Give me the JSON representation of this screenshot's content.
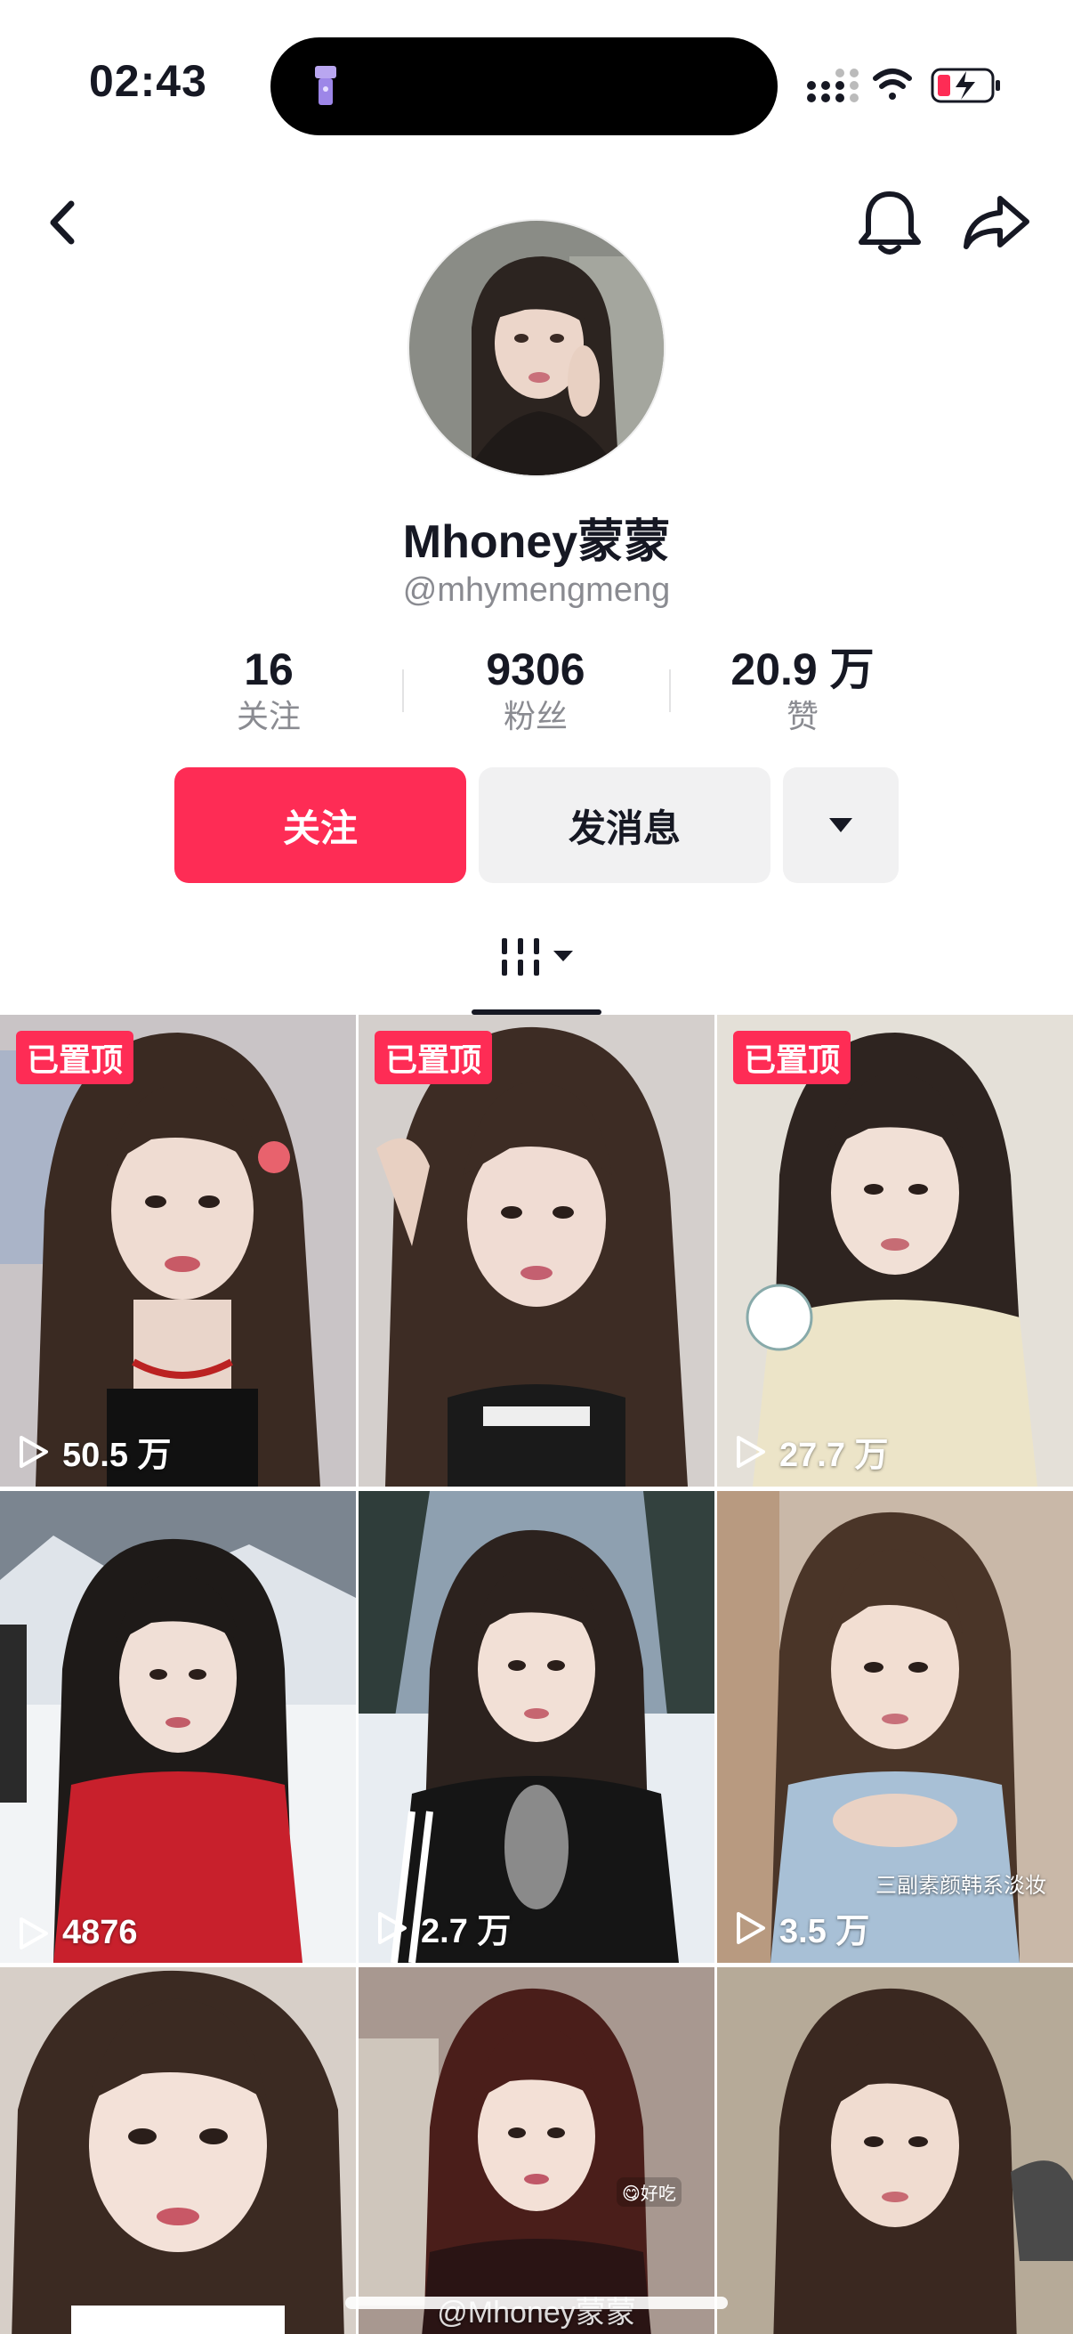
{
  "status_bar": {
    "time": "02:43"
  },
  "profile": {
    "name": "Mhoney蒙蒙",
    "handle": "@mhymengmeng",
    "stats": [
      {
        "value": "16",
        "label": "关注"
      },
      {
        "value": "9306",
        "label": "粉丝"
      },
      {
        "value": "20.9 万",
        "label": "赞"
      }
    ]
  },
  "actions": {
    "follow_label": "关注",
    "message_label": "发消息"
  },
  "colors": {
    "accent": "#fe2c55",
    "secondary_btn": "#f1f1f2"
  },
  "videos": [
    {
      "pinned": "已置顶",
      "views": "50.5 万"
    },
    {
      "pinned": "已置顶",
      "views": ""
    },
    {
      "pinned": "已置顶",
      "views": "27.7 万"
    },
    {
      "pinned": "",
      "views": "4876"
    },
    {
      "pinned": "",
      "views": "2.7 万"
    },
    {
      "pinned": "",
      "views": "3.5 万",
      "caption": "三副素颜韩系淡妆"
    },
    {
      "pinned": "",
      "views": ""
    },
    {
      "pinned": "",
      "views": "",
      "sticker": "😋好吃"
    },
    {
      "pinned": "",
      "views": ""
    }
  ],
  "watermark": "@Mhoney蒙蒙"
}
